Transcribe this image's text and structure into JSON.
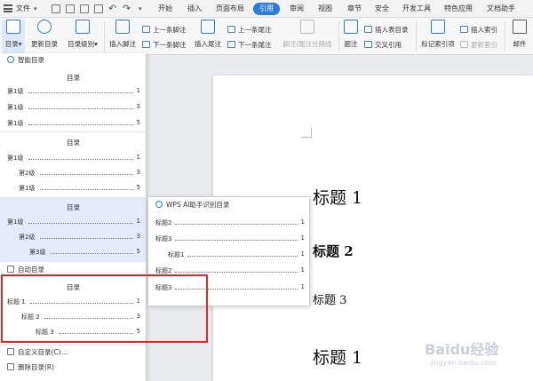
{
  "menubar": {
    "file_label": "文件",
    "tabs": [
      "开始",
      "插入",
      "页面布局",
      "引用",
      "审阅",
      "视图",
      "章节",
      "安全",
      "开发工具",
      "特色应用",
      "文档助手"
    ],
    "active_tab": "引用"
  },
  "ribbon": {
    "toc_label": "目录",
    "update_toc_label": "更新目录",
    "toc_level_label": "目录级别",
    "insert_footnote_label": "插入脚注",
    "prev_footnote_label": "上一条脚注",
    "next_footnote_label": "下一条脚注",
    "insert_endnote_label": "插入尾注",
    "prev_endnote_label": "上一条尾注",
    "next_endnote_label": "下一条尾注",
    "footnote_separator_label": "脚注/尾注分隔线",
    "caption_label": "题注",
    "insert_table_toc_label": "插入表目录",
    "cross_ref_label": "交叉引用",
    "mark_index_label": "标记索引项",
    "insert_index_label": "插入索引",
    "update_index_label": "更新索引",
    "mail_label": "邮件"
  },
  "toc_panel": {
    "smart_toc_header": "智能目录",
    "template1": {
      "title": "目录",
      "lines": [
        {
          "text": "第1级",
          "page": "1"
        },
        {
          "text": "第1级",
          "page": "3"
        },
        {
          "text": "第1级",
          "page": "5"
        }
      ]
    },
    "template2": {
      "title": "目录",
      "lines": [
        {
          "text": "第1级",
          "page": "1"
        },
        {
          "text": "第2级",
          "page": "3"
        },
        {
          "text": "第1级",
          "page": "5"
        }
      ]
    },
    "template3": {
      "title": "目录",
      "lines": [
        {
          "text": "第1级",
          "page": "1"
        },
        {
          "text": "第2级",
          "page": "3"
        },
        {
          "text": "第3级",
          "page": "5"
        }
      ]
    },
    "auto_toc_header": "自动目录",
    "auto_template": {
      "title": "目录",
      "lines": [
        {
          "text": "标题 1",
          "page": "1"
        },
        {
          "text": "标题 2",
          "page": "3"
        },
        {
          "text": "标题 3",
          "page": "5"
        }
      ]
    },
    "custom_toc_label": "自定义目录(C)...",
    "delete_toc_label": "删除目录(R)"
  },
  "ai_panel": {
    "header": "WPS AI助手识别目录",
    "lines": [
      {
        "text": "标题2",
        "page": "1"
      },
      {
        "text": "标题3",
        "page": "1"
      },
      {
        "text": "标题1",
        "page": "1"
      },
      {
        "text": "标题2",
        "page": "1"
      },
      {
        "text": "标题3",
        "page": "1"
      }
    ]
  },
  "document": {
    "headings": [
      "标题 1",
      "标题 2",
      "标题 3",
      "标题 1"
    ]
  },
  "watermark": {
    "text": "Baidu经验",
    "url": "jingyan.baidu.com"
  },
  "colors": {
    "accent": "#2b7be4",
    "highlight_box": "#e32626",
    "selected_template_bg": "#e3ecfb"
  }
}
